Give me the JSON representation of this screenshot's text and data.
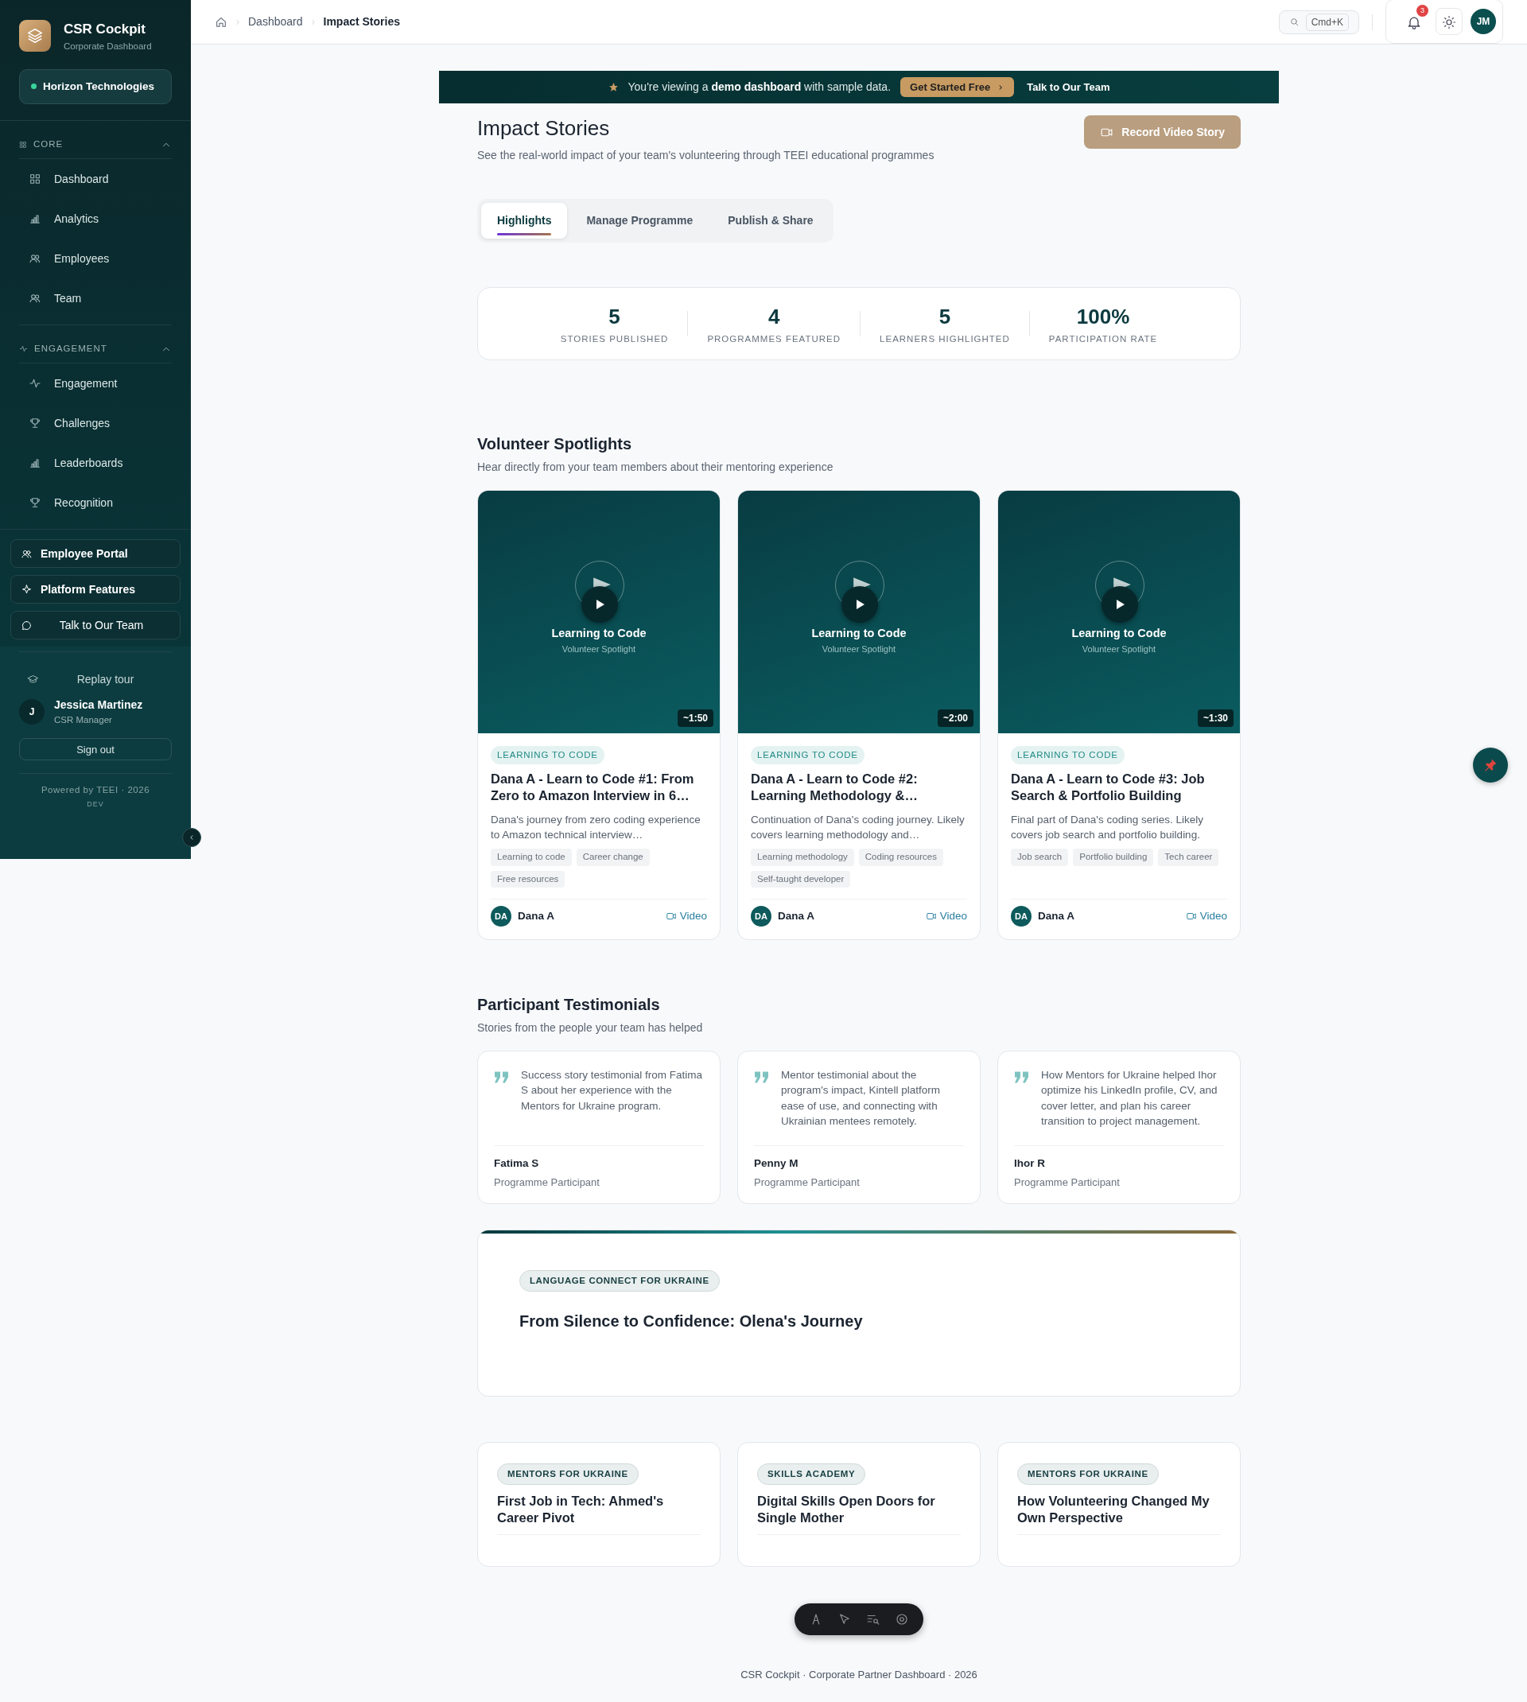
{
  "sidebar": {
    "brand": {
      "title": "CSR Cockpit",
      "subtitle": "Corporate Dashboard"
    },
    "org": {
      "name": "Horizon Technologies"
    },
    "sections": [
      {
        "title": "CORE",
        "expanded": true,
        "items": [
          {
            "label": "Dashboard"
          },
          {
            "label": "Analytics"
          },
          {
            "label": "Employees"
          },
          {
            "label": "Team"
          }
        ]
      },
      {
        "title": "ENGAGEMENT",
        "expanded": true,
        "items": [
          {
            "label": "Engagement"
          },
          {
            "label": "Challenges"
          },
          {
            "label": "Leaderboards"
          },
          {
            "label": "Recognition"
          }
        ]
      }
    ],
    "links": [
      "Employee Portal",
      "Platform Features",
      "Talk to Our Team"
    ],
    "replay": "Replay tour",
    "user": {
      "initial": "J",
      "name": "Jessica Martinez",
      "role": "CSR Manager"
    },
    "sign_out": "Sign out",
    "powered": "Powered by TEEI · 2026",
    "env": "DEV"
  },
  "topbar": {
    "breadcrumb": [
      "Dashboard",
      "Impact Stories"
    ],
    "shortcut": "Cmd+K",
    "notifications": "3",
    "avatar": "JM"
  },
  "banner": {
    "text": "You're viewing a **demo dashboard** with sample data.",
    "cta": "Get Started Free",
    "link": "Talk to Our Team"
  },
  "header": {
    "title": "Impact Stories",
    "subtitle": "See the real-world impact of your team's volunteering through TEEI educational programmes",
    "button": "Record Video Story"
  },
  "tabs": [
    {
      "label": "Highlights",
      "selected": true
    },
    {
      "label": "Manage Programme",
      "selected": false
    },
    {
      "label": "Publish & Share",
      "selected": false
    }
  ],
  "stats": [
    {
      "value": "5",
      "label": "STORIES PUBLISHED"
    },
    {
      "value": "4",
      "label": "PROGRAMMES FEATURED"
    },
    {
      "value": "5",
      "label": "LEARNERS HIGHLIGHTED"
    },
    {
      "value": "100%",
      "label": "PARTICIPATION RATE"
    }
  ],
  "spotlights": {
    "title": "Volunteer Spotlights",
    "subtitle": "Hear directly from your team members about their mentoring experience",
    "videos": [
      {
        "thumb_title": "Learning to Code",
        "thumb_subtitle": "Volunteer Spotlight",
        "duration": "~1:50",
        "tag": "LEARNING TO CODE",
        "title": "Dana A - Learn to Code #1: From Zero to Amazon Interview in 6…",
        "description": "Dana's journey from zero coding experience to Amazon technical interview…",
        "tags": [
          "Learning to code",
          "Career change",
          "Free resources"
        ],
        "initials": "DA",
        "author": "Dana A",
        "link": "Video"
      },
      {
        "thumb_title": "Learning to Code",
        "thumb_subtitle": "Volunteer Spotlight",
        "duration": "~2:00",
        "tag": "LEARNING TO CODE",
        "title": "Dana A - Learn to Code #2: Learning Methodology &…",
        "description": "Continuation of Dana's coding journey. Likely covers learning methodology and…",
        "tags": [
          "Learning methodology",
          "Coding resources",
          "Self-taught developer"
        ],
        "initials": "DA",
        "author": "Dana A",
        "link": "Video"
      },
      {
        "thumb_title": "Learning to Code",
        "thumb_subtitle": "Volunteer Spotlight",
        "duration": "~1:30",
        "tag": "LEARNING TO CODE",
        "title": "Dana A - Learn to Code #3: Job Search & Portfolio Building",
        "description": "Final part of Dana's coding series. Likely covers job search and portfolio building.",
        "tags": [
          "Job search",
          "Portfolio building",
          "Tech career"
        ],
        "initials": "DA",
        "author": "Dana A",
        "link": "Video"
      }
    ]
  },
  "testimonials": {
    "title": "Participant Testimonials",
    "subtitle": "Stories from the people your team has helped",
    "items": [
      {
        "quote": "Success story testimonial from Fatima S about her experience with the Mentors for Ukraine program.",
        "name": "Fatima S",
        "role": "Programme Participant"
      },
      {
        "quote": "Mentor testimonial about the program's impact, Kintell platform ease of use, and connecting with Ukrainian mentees remotely.",
        "name": "Penny M",
        "role": "Programme Participant"
      },
      {
        "quote": "How Mentors for Ukraine helped Ihor optimize his LinkedIn profile, CV, and cover letter, and plan his career transition to project management.",
        "name": "Ihor R",
        "role": "Programme Participant"
      }
    ]
  },
  "featured": {
    "tag": "LANGUAGE CONNECT FOR UKRAINE",
    "title": "From Silence to Confidence: Olena's Journey"
  },
  "stories": [
    {
      "tag": "MENTORS FOR UKRAINE",
      "title": "First Job in Tech: Ahmed's Career Pivot"
    },
    {
      "tag": "SKILLS ACADEMY",
      "title": "Digital Skills Open Doors for Single Mother"
    },
    {
      "tag": "MENTORS FOR UKRAINE",
      "title": "How Volunteering Changed My Own Perspective"
    }
  ],
  "footer": "CSR Cockpit · Corporate Partner Dashboard · 2026"
}
